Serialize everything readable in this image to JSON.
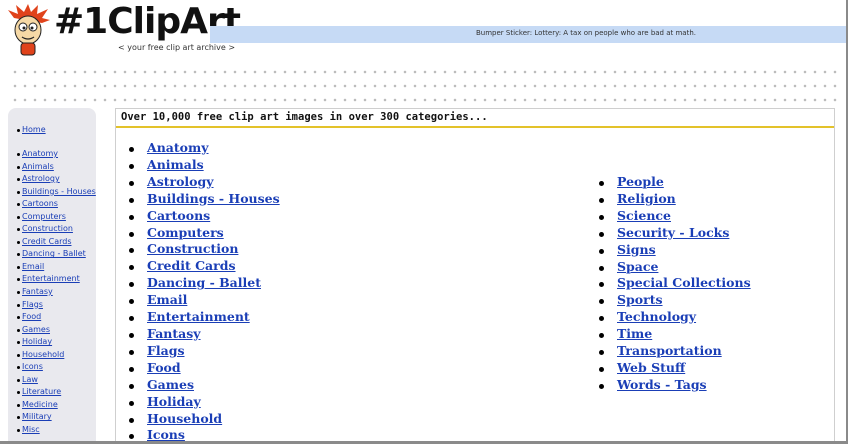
{
  "header": {
    "logo_text": "#1ClipArt",
    "logo_small": "free",
    "bumper_sticker": "Bumper Sticker: Lottery: A tax on people who are bad at math.",
    "tagline": "< your free clip art archive >"
  },
  "main": {
    "heading": "Over 10,000 free clip art images in over 300 categories...",
    "left_categories": [
      "Anatomy",
      "Animals",
      "Astrology",
      "Buildings - Houses",
      "Cartoons",
      "Computers",
      "Construction",
      "Credit Cards",
      "Dancing - Ballet",
      "Email",
      "Entertainment",
      "Fantasy",
      "Flags",
      "Food",
      "Games",
      "Holiday",
      "Household",
      "Icons"
    ],
    "right_categories": [
      "People",
      "Religion",
      "Science",
      "Security - Locks",
      "Signs",
      "Space",
      "Special Collections",
      "Sports",
      "Technology",
      "Time",
      "Transportation",
      "Web Stuff",
      "Words - Tags"
    ]
  },
  "sidebar": {
    "home": "Home",
    "items": [
      "Anatomy",
      "Animals",
      "Astrology",
      "Buildings - Houses",
      "Cartoons",
      "Computers",
      "Construction",
      "Credit Cards",
      "Dancing - Ballet",
      "Email",
      "Entertainment",
      "Fantasy",
      "Flags",
      "Food",
      "Games",
      "Holiday",
      "Household",
      "Icons",
      "Law",
      "Literature",
      "Medicine",
      "Military",
      "Misc"
    ]
  },
  "colors": {
    "link": "#1a3eb6",
    "header_bar": "#c6daf5",
    "heading_underline": "#e3c22a",
    "sidebar_bg": "#e9e9ee"
  },
  "icons": [
    "mascot-icon"
  ]
}
